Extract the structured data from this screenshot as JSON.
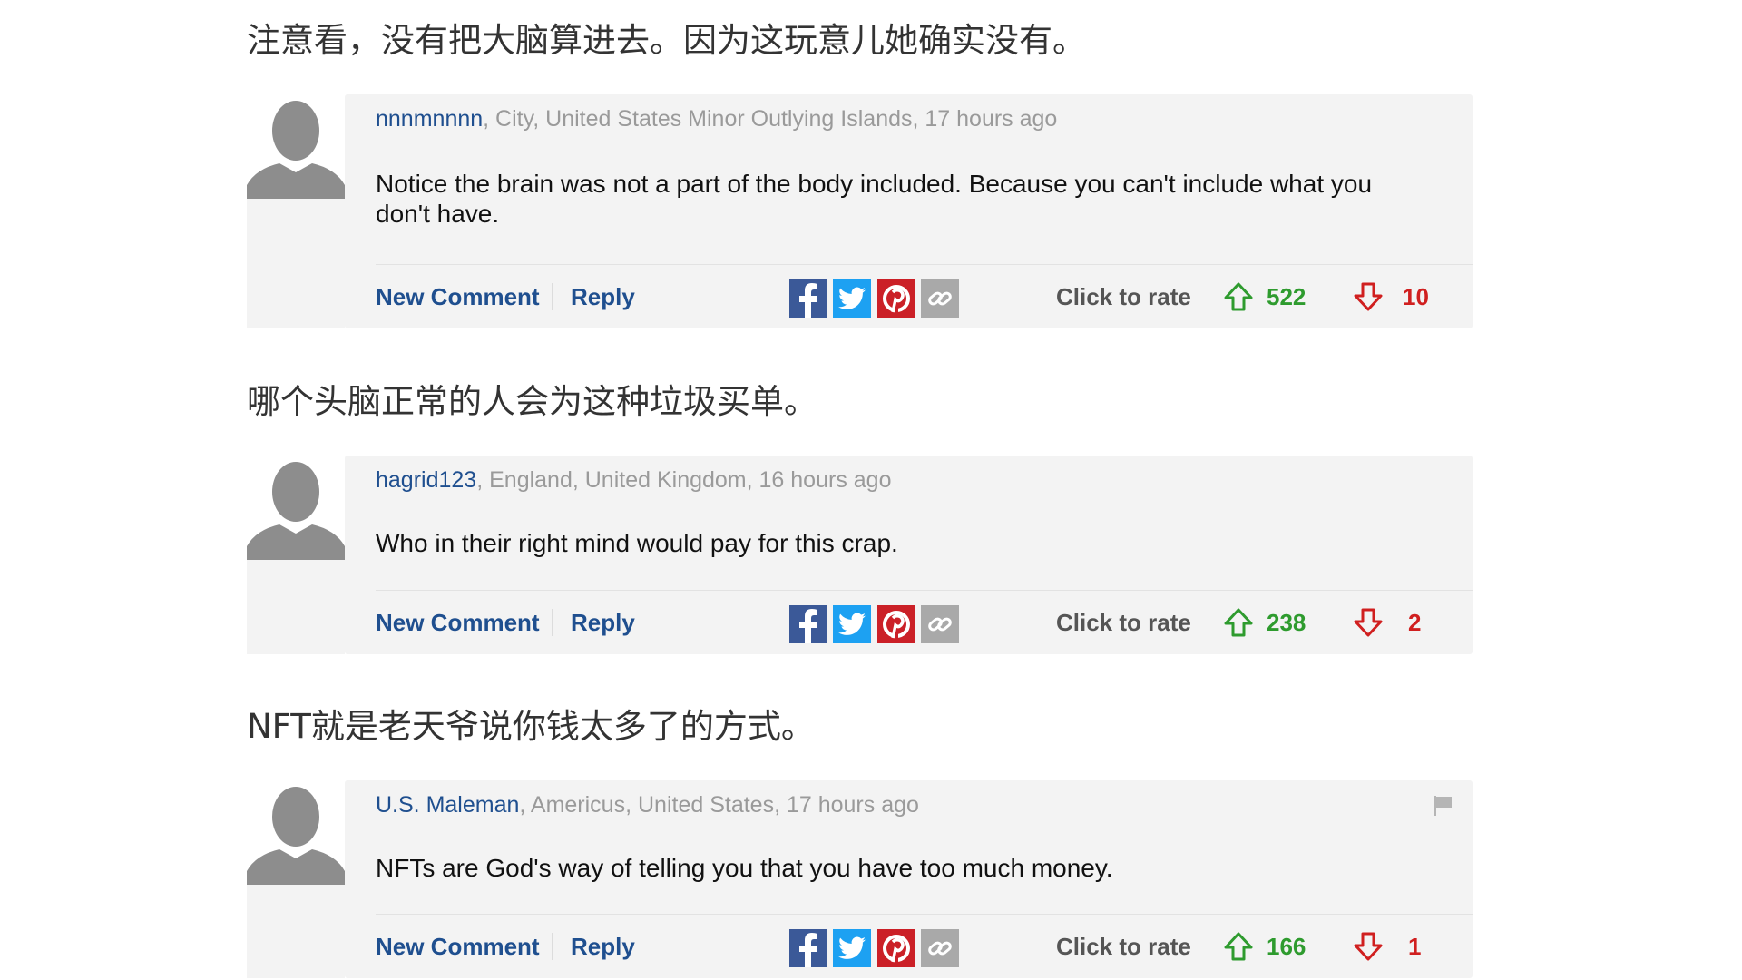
{
  "comments": [
    {
      "caption": "注意看，没有把大脑算进去。因为这玩意儿她确实没有。",
      "username": "nnnmnnnn",
      "location": ", City, United States Minor Outlying Islands, 17 hours ago",
      "text": "Notice the brain was not a part of the body included. Because you can't include what you don't have.",
      "new_comment_label": "New Comment",
      "reply_label": "Reply",
      "rate_label": "Click to rate",
      "upvotes": "522",
      "downvotes": "10",
      "flag": false
    },
    {
      "caption": "哪个头脑正常的人会为这种垃圾买单。",
      "username": "hagrid123",
      "location": ", England, United Kingdom, 16 hours ago",
      "text": "Who in their right mind would pay for this crap.",
      "new_comment_label": "New Comment",
      "reply_label": "Reply",
      "rate_label": "Click to rate",
      "upvotes": "238",
      "downvotes": "2",
      "flag": false
    },
    {
      "caption": "NFT就是老天爷说你钱太多了的方式。",
      "username": "U.S. Maleman",
      "location": ", Americus, United States, 17 hours ago",
      "text": "NFTs are God's way of telling you that you have too much money.",
      "new_comment_label": "New Comment",
      "reply_label": "Reply",
      "rate_label": "Click to rate",
      "upvotes": "166",
      "downvotes": "1",
      "flag": true
    }
  ],
  "colors": {
    "username": "#1f4f8f",
    "upvote": "#2e9b2e",
    "downvote": "#d01f1f",
    "facebook": "#3b5998",
    "twitter": "#1da1f2",
    "pinterest": "#cb2027",
    "link": "#9a9a9a"
  },
  "icons": [
    "avatar-icon",
    "facebook-icon",
    "twitter-icon",
    "pinterest-icon",
    "link-icon",
    "upvote-arrow-icon",
    "downvote-arrow-icon",
    "flag-icon"
  ]
}
